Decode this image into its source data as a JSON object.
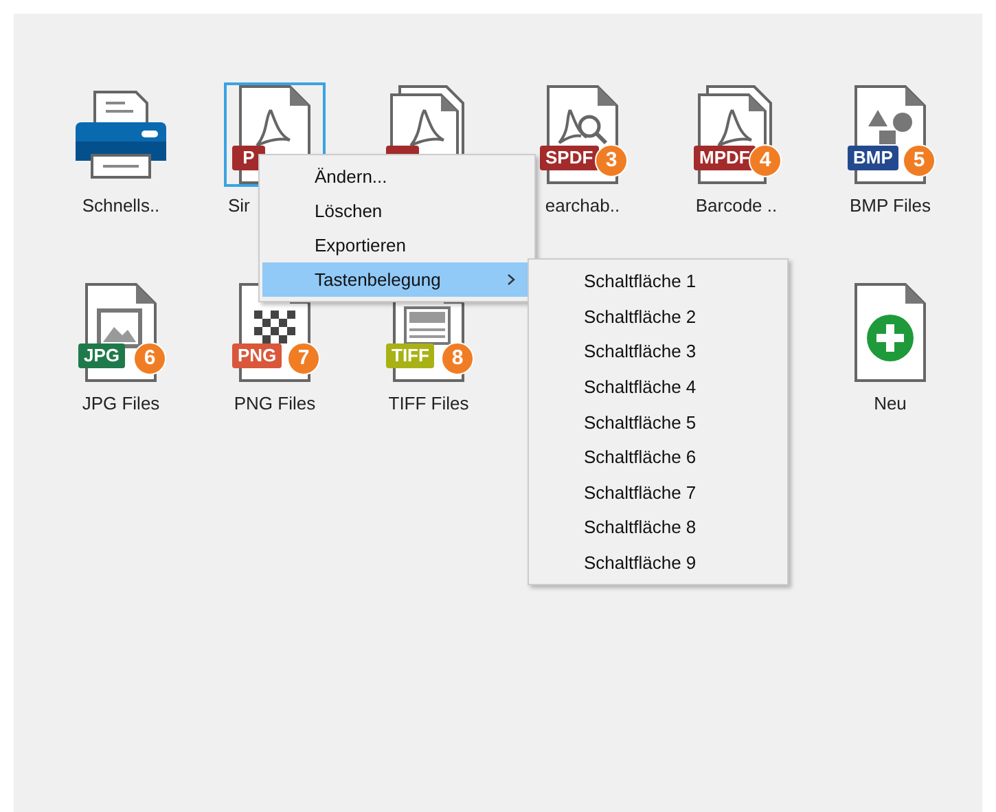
{
  "tiles": [
    {
      "kind": "printer",
      "label": "Schnells..",
      "selected": false
    },
    {
      "kind": "pdf",
      "stacked": false,
      "label": "Sir",
      "selected": true,
      "badge": {
        "text": "P",
        "color": "#a32b2b"
      }
    },
    {
      "kind": "pdf",
      "stacked": true,
      "selected": false,
      "badge": {
        "color": "#a32b2b"
      }
    },
    {
      "kind": "search",
      "stacked": false,
      "label": "earchab..",
      "selected": false,
      "badge": {
        "text": "SPDF",
        "color": "#a32b2b"
      },
      "number": "3"
    },
    {
      "kind": "pdf",
      "stacked": true,
      "label": "Barcode ..",
      "selected": false,
      "badge": {
        "text": "MPDF",
        "color": "#a32b2b"
      },
      "number": "4"
    },
    {
      "kind": "shapes",
      "stacked": false,
      "label": "BMP Files",
      "selected": false,
      "badge": {
        "text": "BMP",
        "color": "#24498e"
      },
      "number": "5"
    },
    {
      "kind": "image",
      "stacked": false,
      "label": "JPG Files",
      "selected": false,
      "badge": {
        "text": "JPG",
        "color": "#1e7a4a"
      },
      "number": "6"
    },
    {
      "kind": "checker",
      "stacked": false,
      "label": "PNG Files",
      "selected": false,
      "badge": {
        "text": "PNG",
        "color": "#d9573a"
      },
      "number": "7"
    },
    {
      "kind": "document",
      "stacked": false,
      "label": "TIFF Files",
      "selected": false,
      "badge": {
        "text": "TIFF",
        "color": "#a8b215"
      },
      "number": "8"
    },
    {
      "kind": "new",
      "stacked": false,
      "label": "Neu",
      "selected": false
    }
  ],
  "context_menu": {
    "items": [
      {
        "label": "Ändern...",
        "selected": false,
        "submenu": false
      },
      {
        "label": "Löschen",
        "selected": false,
        "submenu": false
      },
      {
        "label": "Exportieren",
        "selected": false,
        "submenu": false
      },
      {
        "label": "Tastenbelegung",
        "selected": true,
        "submenu": true
      }
    ]
  },
  "submenu": {
    "items": [
      "Schaltfläche 1",
      "Schaltfläche 2",
      "Schaltfläche 3",
      "Schaltfläche 4",
      "Schaltfläche 5",
      "Schaltfläche 6",
      "Schaltfläche 7",
      "Schaltfläche 8",
      "Schaltfläche 9"
    ]
  }
}
